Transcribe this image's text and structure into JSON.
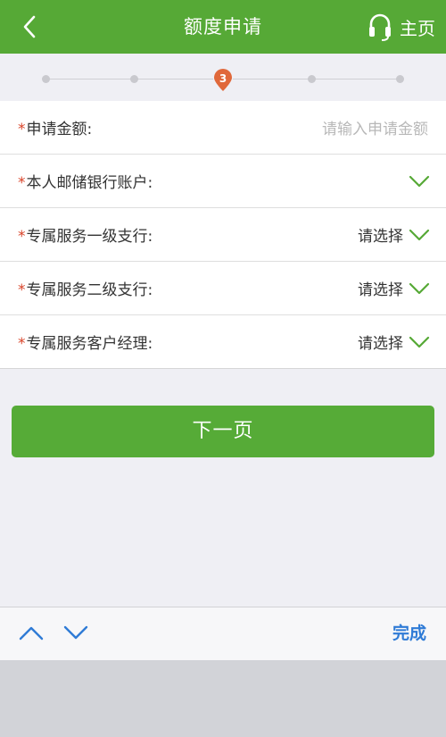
{
  "header": {
    "title": "额度申请",
    "home_label": "主页"
  },
  "progress": {
    "total_steps": 5,
    "current_step": "3"
  },
  "form": {
    "rows": [
      {
        "label": "申请金额:",
        "placeholder": "请输入申请金额",
        "value": ""
      },
      {
        "label": "本人邮储银行账户:",
        "value": ""
      },
      {
        "label": "专属服务一级支行:",
        "value": "请选择"
      },
      {
        "label": "专属服务二级支行:",
        "value": "请选择"
      },
      {
        "label": "专属服务客户经理:",
        "value": "请选择"
      }
    ],
    "required_mark": "*"
  },
  "actions": {
    "next_label": "下一页"
  },
  "keyboard_toolbar": {
    "done_label": "完成"
  },
  "colors": {
    "brand_green": "#56a936",
    "required_red": "#d9442a",
    "step_active": "#e0683a",
    "done_blue": "#2f7bd6"
  },
  "icons": {
    "back": "chevron-left-icon",
    "headset": "headset-icon",
    "dropdown": "chevron-down-icon",
    "prev_field": "chevron-up-icon",
    "next_field": "chevron-down-icon"
  }
}
